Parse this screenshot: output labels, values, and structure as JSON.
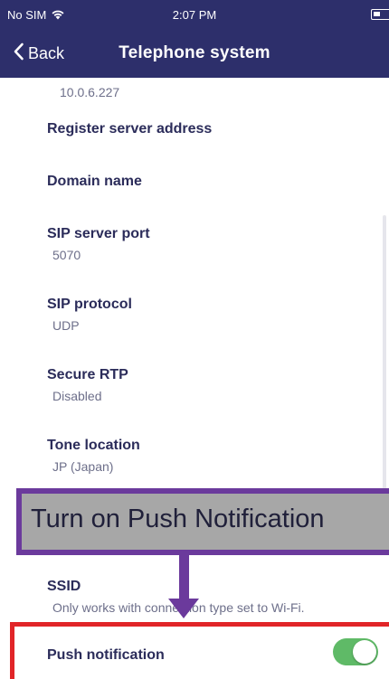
{
  "status_bar": {
    "carrier": "No SIM",
    "time": "2:07 PM"
  },
  "nav": {
    "back_label": "Back",
    "title": "Telephone system"
  },
  "list": {
    "cut_off_value": "10.0.6.227",
    "items": [
      {
        "title": "Register server address",
        "value": ""
      },
      {
        "title": "Domain name",
        "value": ""
      },
      {
        "title": "SIP server port",
        "value": "5070"
      },
      {
        "title": "SIP protocol",
        "value": "UDP"
      },
      {
        "title": "Secure RTP",
        "value": "Disabled"
      },
      {
        "title": "Tone location",
        "value": "JP (Japan)"
      },
      {
        "title": "SSID",
        "value": "Only works with connection type set to Wi-Fi."
      },
      {
        "title": "Push notification",
        "value": ""
      }
    ]
  },
  "push_toggle": {
    "on": true,
    "color": "#5fba67"
  },
  "annotation": {
    "callout_text": "Turn on Push Notification",
    "callout_color": "#6b3a9c",
    "highlight_color": "#e12528"
  },
  "colors": {
    "nav_background": "#2d2f6b",
    "text_primary": "#2b2c5a",
    "text_secondary": "#6d6f8a"
  }
}
